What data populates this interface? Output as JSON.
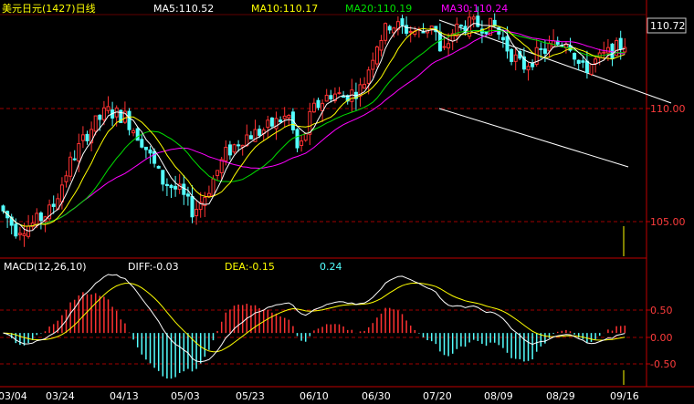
{
  "header": {
    "instrument": "美元日元(1427)日线",
    "ma5": "MA5:110.52",
    "ma10": "MA10:110.17",
    "ma20": "MA20:110.19",
    "ma30": "MA30:110.24"
  },
  "price_badge": "110.72",
  "macd_header": {
    "name": "MACD(12,26,10)",
    "diff": "DIFF:-0.03",
    "dea": "DEA:-0.15",
    "macd": "0.24"
  },
  "colors": {
    "background": "#000000",
    "up": "#ff3232",
    "down": "#54ffff",
    "ma5": "#ffffff",
    "ma10": "#ffff00",
    "ma20": "#00e000",
    "ma30": "#ff00ff",
    "grid": "#a00000",
    "axis": "#c00000"
  },
  "chart_data": [
    {
      "type": "candlestick",
      "title": "美元日元(1427)日线",
      "x": [
        "03/04",
        "03/24",
        "04/13",
        "05/03",
        "05/23",
        "06/10",
        "06/30",
        "07/20",
        "08/09",
        "08/29",
        "09/16"
      ],
      "ylim": [
        103.1,
        111.3
      ],
      "yticks": [
        "110.00",
        "105.00"
      ],
      "moving_averages": [
        "MA5",
        "MA10",
        "MA20",
        "MA30"
      ],
      "last_price": 110.72,
      "grid": true
    },
    {
      "type": "bar",
      "title": "MACD(12,26,10)",
      "series": [
        {
          "name": "DIFF",
          "last": -0.03
        },
        {
          "name": "DEA",
          "last": -0.15
        },
        {
          "name": "MACD",
          "last": 0.24
        }
      ],
      "yticks": [
        "0.50",
        "0.00",
        "-0.50"
      ],
      "ylim": [
        -0.8,
        0.95
      ]
    }
  ]
}
